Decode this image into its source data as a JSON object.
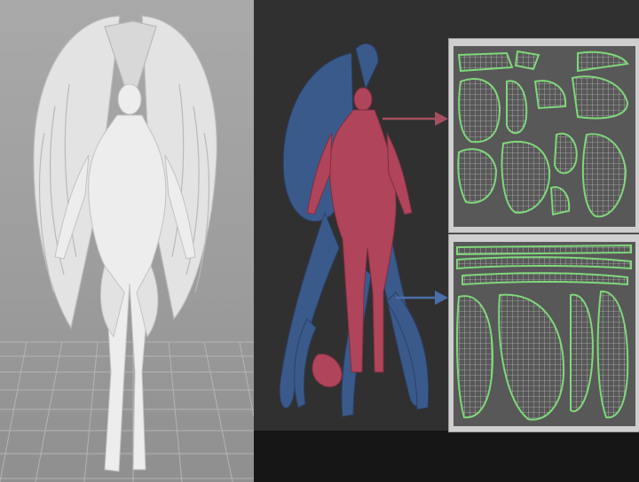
{
  "colors": {
    "left_background": "#a3a3a3",
    "sculpt_white": "#ececec",
    "dark_background": "#303030",
    "blue_mesh": "#3b5a8c",
    "red_mesh": "#b0445a",
    "uv_background": "#585858",
    "uv_seam_green": "#7fd87a",
    "arrow_red": "#a55060",
    "arrow_blue": "#4a6ea8"
  },
  "icons": [
    "arrow-right-icon"
  ]
}
